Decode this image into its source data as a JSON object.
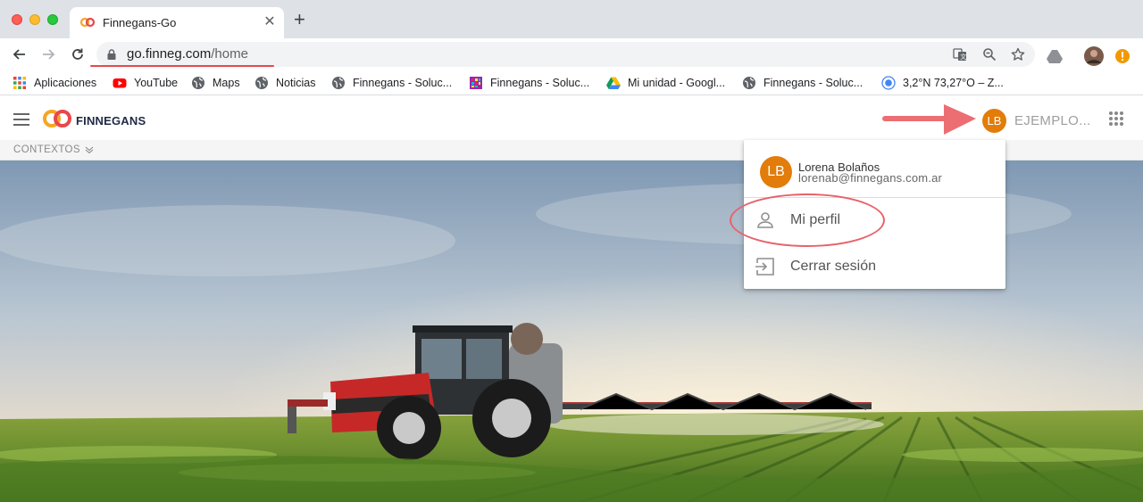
{
  "browser": {
    "tab_title": "Finnegans-Go",
    "tab_close": "✕",
    "new_tab": "+",
    "url_host": "go.finneg.com",
    "url_path": "/home",
    "bookmarks": [
      {
        "label": "Aplicaciones",
        "icon": "apps-grid-icon"
      },
      {
        "label": "YouTube",
        "icon": "youtube-icon"
      },
      {
        "label": "Maps",
        "icon": "globe-icon"
      },
      {
        "label": "Noticias",
        "icon": "globe-icon"
      },
      {
        "label": "Finnegans - Soluc...",
        "icon": "globe-icon"
      },
      {
        "label": "Finnegans - Soluc...",
        "icon": "finnegans-tile-icon"
      },
      {
        "label": "Mi unidad - Googl...",
        "icon": "google-drive-icon"
      },
      {
        "label": "Finnegans - Soluc...",
        "icon": "globe-icon"
      },
      {
        "label": "3,2°N 73,27°O – Z...",
        "icon": "location-icon"
      }
    ]
  },
  "app": {
    "logo_text": "FINNEGANS",
    "user_initials": "LB",
    "company": "EJEMPLO...",
    "contexts_label": "CONTEXTOS"
  },
  "profile_menu": {
    "initials": "LB",
    "name": "Lorena Bolaños",
    "email": "lorenab@finnegans.com.ar",
    "items": [
      {
        "label": "Mi perfil",
        "icon": "person-icon"
      },
      {
        "label": "Cerrar sesión",
        "icon": "logout-icon"
      }
    ]
  },
  "colors": {
    "accent_orange": "#e27c0a",
    "annotation_red": "#e8626a"
  }
}
